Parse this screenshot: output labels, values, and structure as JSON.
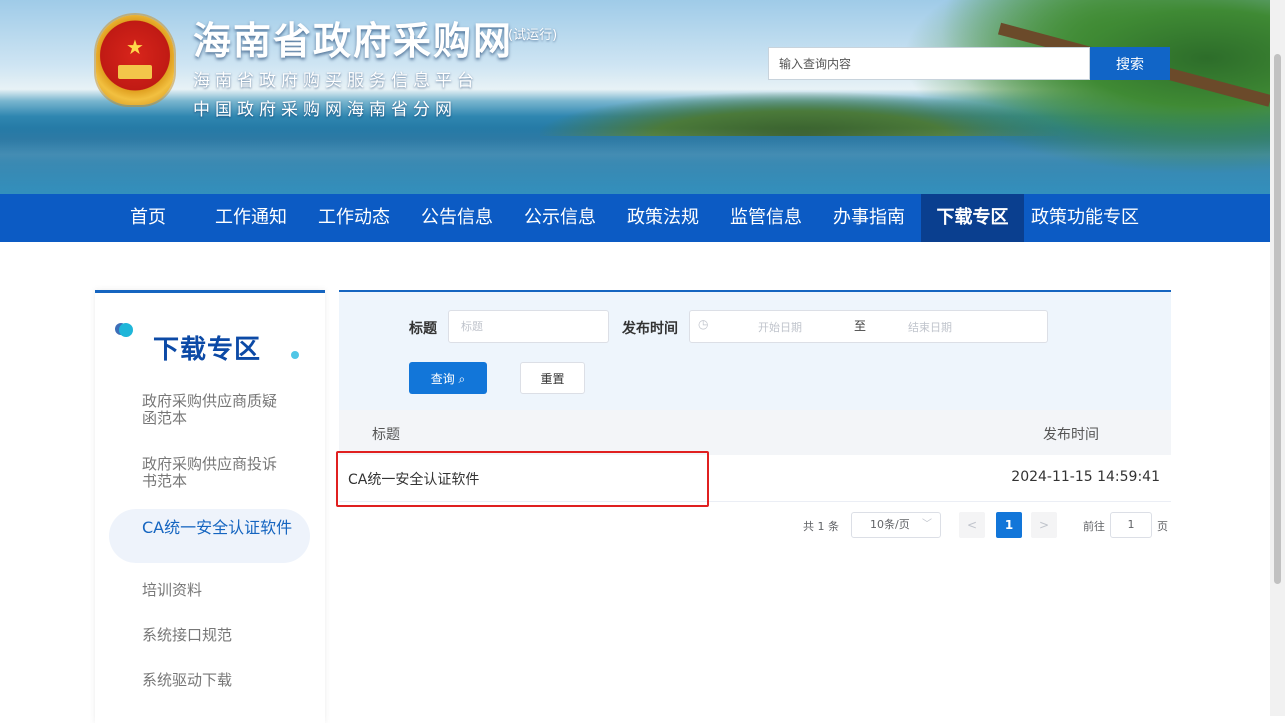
{
  "header": {
    "title": "海南省政府采购网",
    "trial": "(试运行)",
    "subtitle1": "海南省政府购买服务信息平台",
    "subtitle2": "中国政府采购网海南省分网",
    "search_placeholder": "输入查询内容",
    "search_button": "搜索"
  },
  "nav": {
    "items": [
      "首页",
      "工作通知",
      "工作动态",
      "公告信息",
      "公示信息",
      "政策法规",
      "监管信息",
      "办事指南",
      "下载专区",
      "政策功能专区"
    ],
    "active": "下载专区"
  },
  "sidebar": {
    "title": "下载专区",
    "items": [
      {
        "label": "政府采购供应商质疑函范本"
      },
      {
        "label": "政府采购供应商投诉书范本"
      },
      {
        "label": "CA统一安全认证软件",
        "active": true
      },
      {
        "label": "培训资料"
      },
      {
        "label": "系统接口规范"
      },
      {
        "label": "系统驱动下载"
      }
    ]
  },
  "filter": {
    "title_label": "标题",
    "title_placeholder": "标题",
    "time_label": "发布时间",
    "start_placeholder": "开始日期",
    "range_sep": "至",
    "end_placeholder": "结束日期",
    "query_button": "查询",
    "reset_button": "重置"
  },
  "table": {
    "columns": [
      "标题",
      "发布时间"
    ],
    "rows": [
      {
        "title": "CA统一安全认证软件",
        "time": "2024-11-15 14:59:41"
      }
    ]
  },
  "pagination": {
    "total": "共 1 条",
    "page_size": "10条/页",
    "current": "1",
    "goto_label": "前往",
    "goto_value": "1",
    "page_unit": "页"
  },
  "colors": {
    "nav_bg": "#0c5bc4",
    "nav_active": "#0a3f8f",
    "primary": "#1276d9",
    "highlight": "#e02020"
  }
}
